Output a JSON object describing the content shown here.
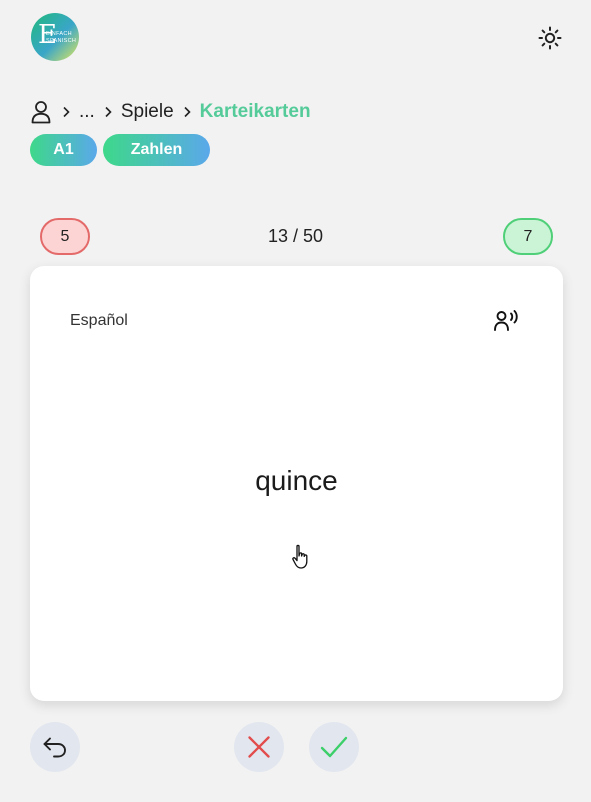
{
  "header": {
    "logo_text_line1": "Einfach",
    "logo_text_line2": "Spanisch",
    "logo_mark": "E"
  },
  "breadcrumb": {
    "ellipsis": "...",
    "parent": "Spiele",
    "current": "Karteikarten"
  },
  "tags": {
    "level": "A1",
    "topic": "Zahlen"
  },
  "stats": {
    "wrong_count": "5",
    "progress": "13 / 50",
    "right_count": "7"
  },
  "card": {
    "language": "Español",
    "word": "quince"
  },
  "icons": {
    "theme": "sun-icon",
    "user": "user-icon",
    "audio": "speaking-person-icon",
    "undo": "undo-icon",
    "wrong": "x-icon",
    "right": "check-icon"
  },
  "colors": {
    "accent": "#55cb9a",
    "wrong_bg": "#fcd4d4",
    "wrong_border": "#e46a6a",
    "right_bg": "#cbf4d6",
    "right_border": "#4fcf78",
    "wrong_icon": "#e24c4c",
    "right_icon": "#3ccf6a"
  }
}
